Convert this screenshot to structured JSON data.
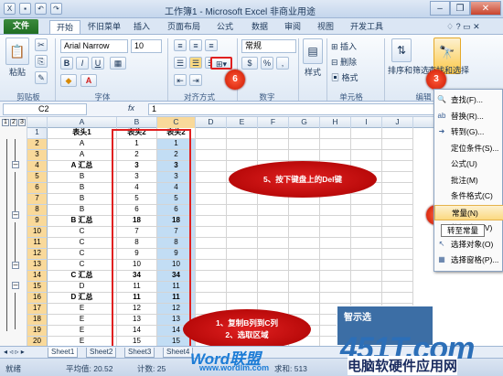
{
  "window": {
    "title": "工作簿1 - Microsoft Excel 非商业用途"
  },
  "tabs": [
    "文件",
    "开始",
    "怀旧菜单",
    "插入",
    "页面布局",
    "公式",
    "数据",
    "审阅",
    "视图",
    "开发工具"
  ],
  "ribbon": {
    "paste": "粘贴",
    "clipboard": "剪贴板",
    "font_name": "Arial Narrow",
    "font_size": "10",
    "font_group": "字体",
    "align_group": "对齐方式",
    "number_format": "常规",
    "number_group": "数字",
    "style": "样式",
    "insert": "插入",
    "delete": "删除",
    "format": "格式",
    "cells_group": "单元格",
    "sort": "排序和筛选",
    "find": "查找和选择",
    "edit_group": "编辑",
    "bold": "B",
    "italic": "I",
    "underline": "U",
    "percent": "%",
    "currency": "$"
  },
  "formula_bar": {
    "name_box": "C2",
    "fx": "fx",
    "value": "1"
  },
  "columns": [
    "A",
    "B",
    "C",
    "D",
    "E",
    "F",
    "G",
    "H",
    "I",
    "J"
  ],
  "rows": [
    {
      "n": "1",
      "a": "表头1",
      "b": "表头2",
      "c": "表头2",
      "bold": false
    },
    {
      "n": "2",
      "a": "A",
      "b": "1",
      "c": "1"
    },
    {
      "n": "3",
      "a": "A",
      "b": "2",
      "c": "2"
    },
    {
      "n": "4",
      "a": "A 汇总",
      "b": "3",
      "c": "3",
      "bold": true
    },
    {
      "n": "5",
      "a": "B",
      "b": "3",
      "c": "3"
    },
    {
      "n": "6",
      "a": "B",
      "b": "4",
      "c": "4"
    },
    {
      "n": "7",
      "a": "B",
      "b": "5",
      "c": "5"
    },
    {
      "n": "8",
      "a": "B",
      "b": "6",
      "c": "6"
    },
    {
      "n": "9",
      "a": "B 汇总",
      "b": "18",
      "c": "18",
      "bold": true
    },
    {
      "n": "10",
      "a": "C",
      "b": "7",
      "c": "7"
    },
    {
      "n": "11",
      "a": "C",
      "b": "8",
      "c": "8"
    },
    {
      "n": "12",
      "a": "C",
      "b": "9",
      "c": "9"
    },
    {
      "n": "13",
      "a": "C",
      "b": "10",
      "c": "10"
    },
    {
      "n": "14",
      "a": "C 汇总",
      "b": "34",
      "c": "34",
      "bold": true
    },
    {
      "n": "15",
      "a": "D",
      "b": "11",
      "c": "11"
    },
    {
      "n": "16",
      "a": "D 汇总",
      "b": "11",
      "c": "11",
      "bold": true
    },
    {
      "n": "17",
      "a": "E",
      "b": "12",
      "c": "12"
    },
    {
      "n": "18",
      "a": "E",
      "b": "13",
      "c": "13"
    },
    {
      "n": "19",
      "a": "E",
      "b": "14",
      "c": "14"
    },
    {
      "n": "20",
      "a": "E",
      "b": "15",
      "c": "15"
    }
  ],
  "outline_levels": [
    "1",
    "2",
    "3"
  ],
  "menu": [
    {
      "icon": "find-icon",
      "glyph": "🔍",
      "label": "查找(F)..."
    },
    {
      "icon": "replace-icon",
      "glyph": "ab",
      "label": "替换(R)..."
    },
    {
      "icon": "goto-icon",
      "glyph": "➜",
      "label": "转到(G)..."
    },
    {
      "icon": "",
      "glyph": "",
      "label": "定位条件(S)..."
    },
    {
      "icon": "",
      "glyph": "",
      "label": "公式(U)"
    },
    {
      "icon": "",
      "glyph": "",
      "label": "批注(M)"
    },
    {
      "icon": "",
      "glyph": "",
      "label": "条件格式(C)"
    },
    {
      "icon": "",
      "glyph": "",
      "label": "常量(N)"
    },
    {
      "icon": "",
      "glyph": "",
      "label": "数据验证(V)"
    },
    {
      "icon": "select-objects-icon",
      "glyph": "↖",
      "label": "选择对象(O)"
    },
    {
      "icon": "selection-pane-icon",
      "glyph": "▦",
      "label": "选择窗格(P)..."
    }
  ],
  "tooltip": "转至常量",
  "annotations": {
    "step1": "1、复制B列到C列\n2、选取区域",
    "step5": "5、按下键盘上的Del键",
    "num3": "3",
    "num4": "4",
    "num6": "6"
  },
  "sheets": [
    "Sheet1",
    "Sheet2",
    "Sheet3",
    "Sheet4"
  ],
  "status": {
    "ready": "就绪",
    "average": "平均值: 20.52",
    "count": "计数: 25",
    "sum": "求和: 513"
  },
  "watermark": {
    "brand": "Word联盟",
    "url": "www.wordlm.com",
    "logo": "451T.com",
    "logo_text": "电脑软硬件应用网",
    "panel": "智示选"
  }
}
